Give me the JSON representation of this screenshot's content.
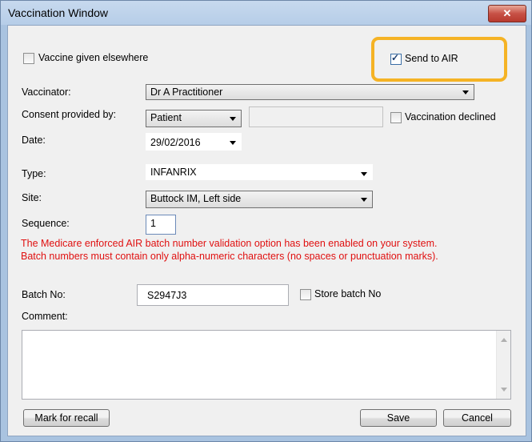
{
  "window": {
    "title": "Vaccination Window",
    "close_glyph": "✕"
  },
  "vaccine_elsewhere": {
    "label": "Vaccine given elsewhere",
    "checked": false
  },
  "send_to_air": {
    "label": "Send to AIR",
    "checked": true,
    "highlight_color": "#f5b325"
  },
  "vaccinator": {
    "label": "Vaccinator:",
    "value": "Dr A Practitioner"
  },
  "consent": {
    "label": "Consent provided by:",
    "value": "Patient",
    "text_value": ""
  },
  "vaccination_declined": {
    "label": "Vaccination declined",
    "checked": false
  },
  "date": {
    "label": "Date:",
    "value": "29/02/2016"
  },
  "type": {
    "label": "Type:",
    "value": "INFANRIX"
  },
  "site": {
    "label": "Site:",
    "value": "Buttock IM, Left side"
  },
  "sequence": {
    "label": "Sequence:",
    "value": "1"
  },
  "warning": {
    "line1": "The Medicare enforced AIR batch number validation option has been enabled on your system.",
    "line2": "Batch numbers must contain only alpha-numeric characters (no spaces or punctuation marks).",
    "color": "#e01010"
  },
  "batch": {
    "label": "Batch No:",
    "value": "S2947J3"
  },
  "store_batch": {
    "label": "Store batch No",
    "checked": false
  },
  "comment": {
    "label": "Comment:",
    "value": ""
  },
  "buttons": {
    "mark_for_recall": "Mark for recall",
    "save": "Save",
    "cancel": "Cancel"
  }
}
